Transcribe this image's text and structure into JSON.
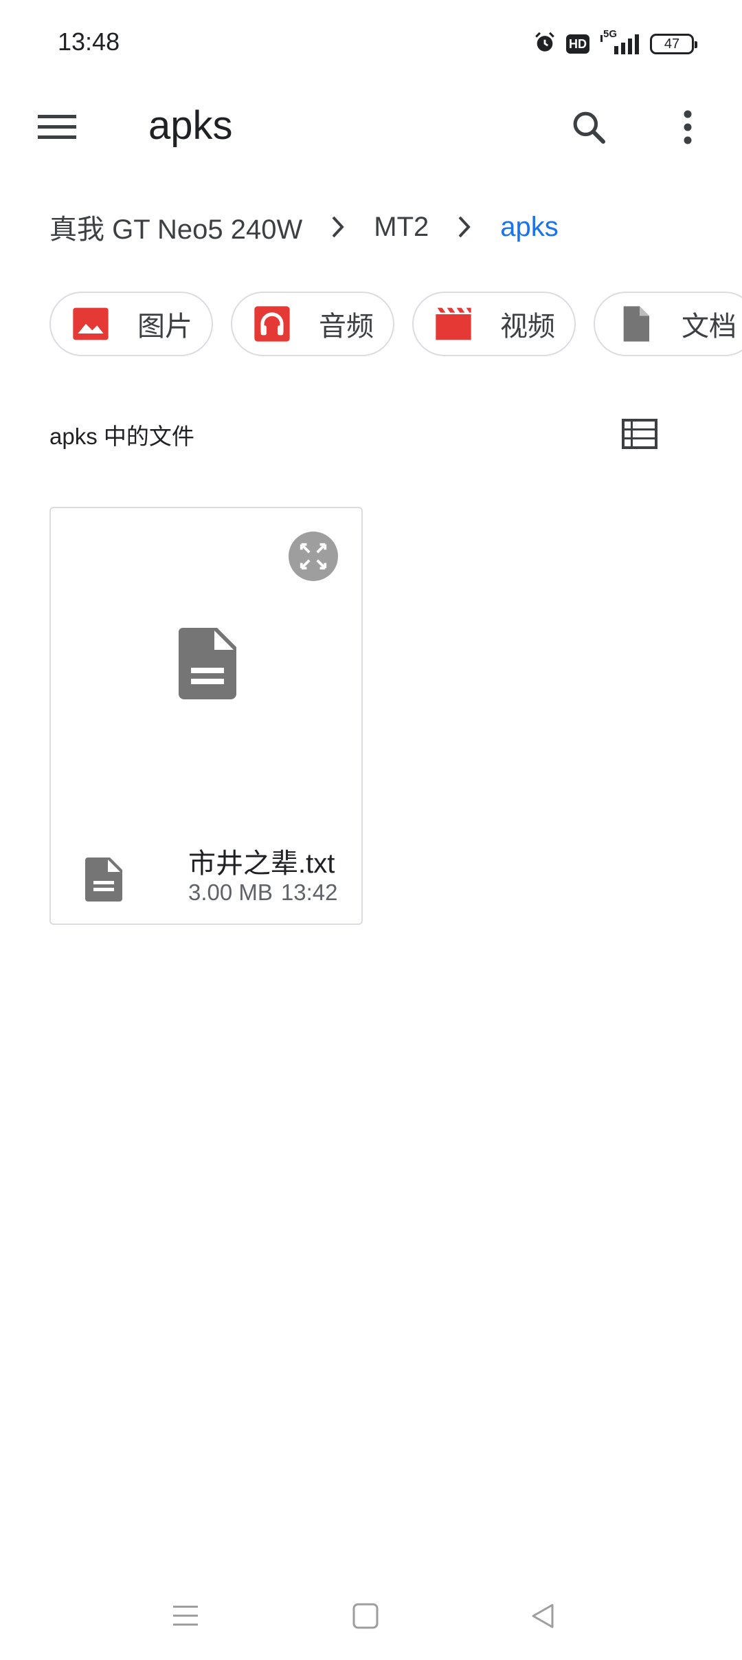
{
  "status_bar": {
    "time": "13:48",
    "icons": [
      "alarm-icon",
      "hd-icon",
      "5g-signal-icon"
    ],
    "hd_label": "HD",
    "network_label": "5G",
    "battery_level": "47"
  },
  "app_bar": {
    "title": "apks",
    "icons": [
      "menu-icon",
      "search-icon",
      "more-vert-icon"
    ]
  },
  "breadcrumb": {
    "items": [
      "真我 GT Neo5 240W",
      "MT2",
      "apks"
    ],
    "current_color": "#1a73e8"
  },
  "chips": [
    {
      "label": "图片",
      "icon": "image-icon",
      "color": "#e53935"
    },
    {
      "label": "音频",
      "icon": "headphones-icon",
      "color": "#e53935"
    },
    {
      "label": "视频",
      "icon": "movie-icon",
      "color": "#e53935"
    },
    {
      "label": "文档",
      "icon": "document-icon",
      "color": "#757575"
    }
  ],
  "section": {
    "title": "apks 中的文件",
    "view_icon": "list-view-icon"
  },
  "files": [
    {
      "name": "市井之辈.txt",
      "size": "3.00 MB",
      "time": "13:42",
      "icon": "text-file-icon"
    }
  ],
  "nav_bar": {
    "icons": [
      "recents-icon",
      "home-icon",
      "back-icon"
    ]
  }
}
